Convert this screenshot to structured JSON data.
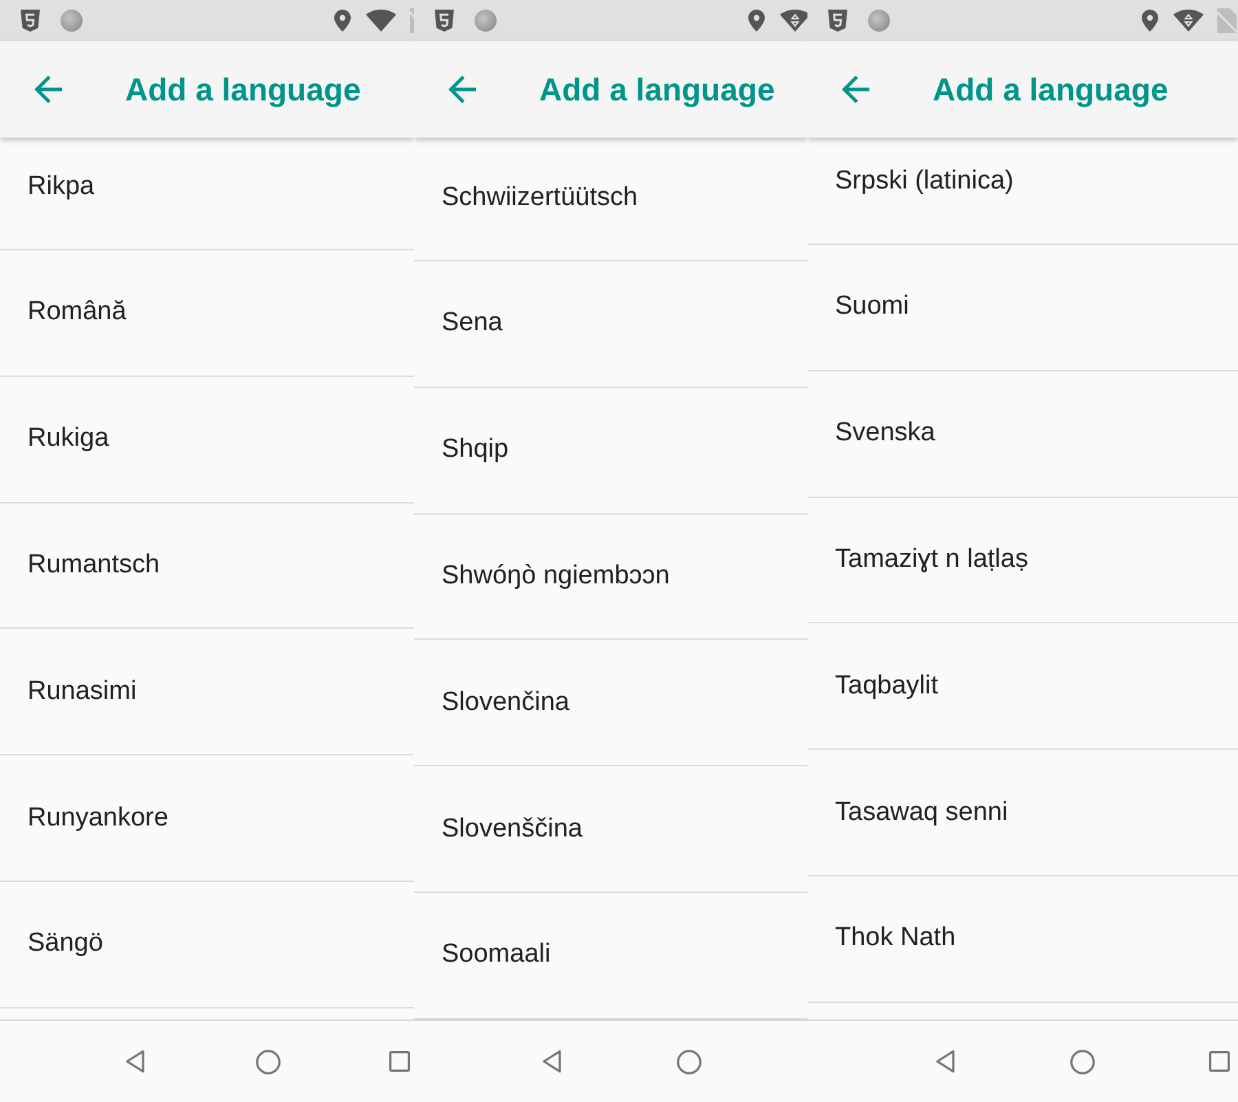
{
  "screens": [
    {
      "app_bar": {
        "title": "Add a language"
      },
      "languages": [
        "Rikpa",
        "Română",
        "Rukiga",
        "Rumantsch",
        "Runasimi",
        "Runyankore",
        "Sängö"
      ]
    },
    {
      "app_bar": {
        "title": "Add a language"
      },
      "languages": [
        "Schwiizertüütsch",
        "Sena",
        "Shqip",
        "Shwóŋò ngiembɔɔn",
        "Slovenčina",
        "Slovenščina",
        "Soomaali"
      ]
    },
    {
      "app_bar": {
        "title": "Add a language"
      },
      "languages": [
        "Srpski (latinica)",
        "Suomi",
        "Svenska",
        "Tamaziɣt n laṭlaṣ",
        "Taqbaylit",
        "Tasawaq senni",
        "Thok Nath"
      ]
    }
  ]
}
